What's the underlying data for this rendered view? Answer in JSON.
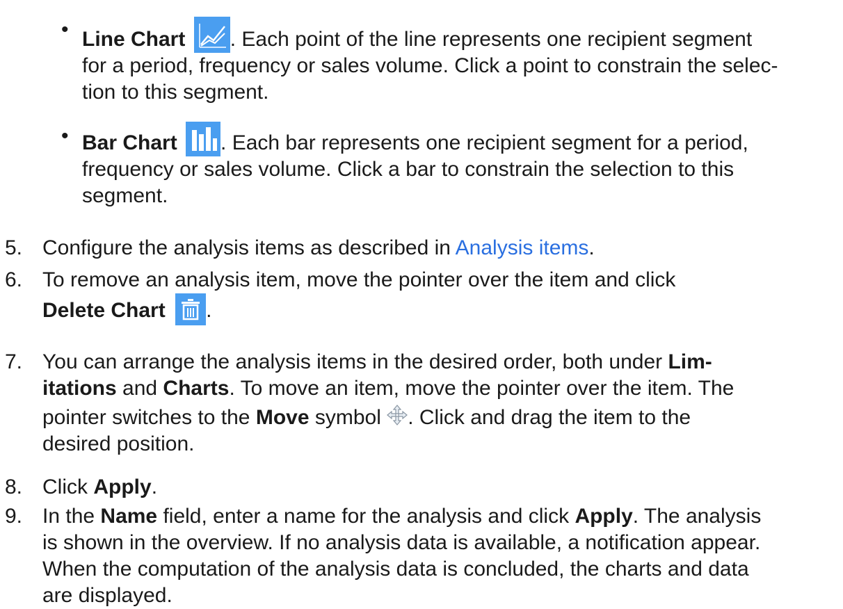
{
  "colors": {
    "icon_blue": "#4a9ef0",
    "link": "#2a6fe0",
    "text": "#1a1a1a"
  },
  "bullets": [
    {
      "term": "Line Chart",
      "icon": "line-chart-icon",
      "text_lines": [
        ". Each point of the line represents one recipient segment",
        "for a period, frequency or sales volume. Click a point to constrain the selec-",
        "tion to this segment."
      ]
    },
    {
      "term": "Bar Chart",
      "icon": "bar-chart-icon",
      "text_lines": [
        ". Each bar represents one recipient segment for a period,",
        "frequency or sales volume. Click a bar to constrain the selection to this",
        "segment."
      ]
    }
  ],
  "steps": {
    "s5": {
      "num": "5.",
      "pre": "Configure the analysis items as described in ",
      "link": "Analysis items",
      "post": "."
    },
    "s6": {
      "num": "6.",
      "l1": "To remove an analysis item, move the pointer over the item and click",
      "bold": "Delete Chart",
      "icon": "trash-icon",
      "end": "."
    },
    "s7": {
      "num": "7.",
      "a": "You can arrange the analysis items in the desired order, both under ",
      "b1": "Lim-",
      "b2": "itations",
      "c": " and ",
      "d": "Charts",
      "e": ". To move an item, move the pointer over the item. The",
      "f": "pointer switches to the ",
      "g": "Move",
      "h": " symbol ",
      "icon": "move-icon",
      "i": ". Click and drag the item to the",
      "j": "desired position."
    },
    "s8": {
      "num": "8.",
      "pre": "Click ",
      "bold": "Apply",
      "post": "."
    },
    "s9": {
      "num": "9.",
      "a": "In the ",
      "b": "Name",
      "c": " field, enter a name for the analysis and click ",
      "d": "Apply",
      "e": ". The analysis",
      "l2": "is shown in the overview. If no analysis data is available, a notification appear.",
      "l3": "When the computation of the analysis data is concluded, the charts and data",
      "l4": "are displayed."
    }
  }
}
